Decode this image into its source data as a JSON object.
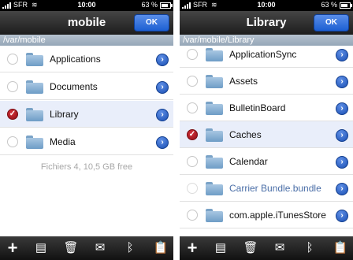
{
  "left": {
    "status": {
      "carrier": "SFR",
      "time": "10:00",
      "battery": "63 %",
      "battery_level": 0.63
    },
    "title": "mobile",
    "ok_label": "OK",
    "path": "/var/mobile",
    "rows": [
      {
        "label": "Applications",
        "checked": false
      },
      {
        "label": "Documents",
        "checked": false
      },
      {
        "label": "Library",
        "checked": true
      },
      {
        "label": "Media",
        "checked": false
      }
    ],
    "footer": "Fichiers 4, 10,5 GB free"
  },
  "right": {
    "status": {
      "carrier": "SFR",
      "time": "10:00",
      "battery": "63 %",
      "battery_level": 0.63
    },
    "title": "Library",
    "ok_label": "OK",
    "path": "/var/mobile/Library",
    "rows": [
      {
        "label": "ApplicationSync",
        "checked": false
      },
      {
        "label": "Assets",
        "checked": false
      },
      {
        "label": "BulletinBoard",
        "checked": false
      },
      {
        "label": "Caches",
        "checked": true
      },
      {
        "label": "Calendar",
        "checked": false
      },
      {
        "label": "Carrier Bundle.bundle",
        "checked": false,
        "link": true
      },
      {
        "label": "com.apple.iTunesStore",
        "checked": false
      }
    ]
  },
  "toolbar": {
    "icons": [
      "plus-icon",
      "zip-icon",
      "trash-icon",
      "mail-icon",
      "bluetooth-icon",
      "clipboard-icon"
    ],
    "glyphs": [
      "+",
      "▤",
      "🗑",
      "✉",
      "ᛒ",
      "📋"
    ]
  },
  "colors": {
    "accent": "#1c5fd2",
    "selected_row": "#e9eefa",
    "checked": "#b0141c",
    "pathbar": "#a5b4c3"
  }
}
